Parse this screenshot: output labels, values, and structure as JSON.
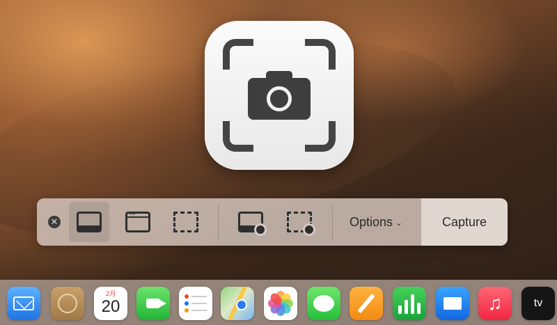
{
  "toolbar": {
    "close_glyph": "✕",
    "modes": [
      {
        "name": "capture-entire-screen",
        "icon": "screen-icon",
        "selected": true
      },
      {
        "name": "capture-selected-window",
        "icon": "window-icon",
        "selected": false
      },
      {
        "name": "capture-selected-portion",
        "icon": "selection-icon",
        "selected": false
      },
      {
        "name": "record-entire-screen",
        "icon": "screen-record-icon",
        "selected": false
      },
      {
        "name": "record-selected-portion",
        "icon": "selection-record-icon",
        "selected": false
      }
    ],
    "options_label": "Options",
    "options_chevron": "⌄",
    "capture_label": "Capture"
  },
  "dock": {
    "calendar_month": "2月",
    "calendar_day": "20",
    "music_glyph": "♫",
    "tv_label": "tv",
    "apple_glyph": ""
  },
  "colors": {
    "accent_dark": "#2e2e2e",
    "toolbar_bg": "#d7c8c0"
  }
}
